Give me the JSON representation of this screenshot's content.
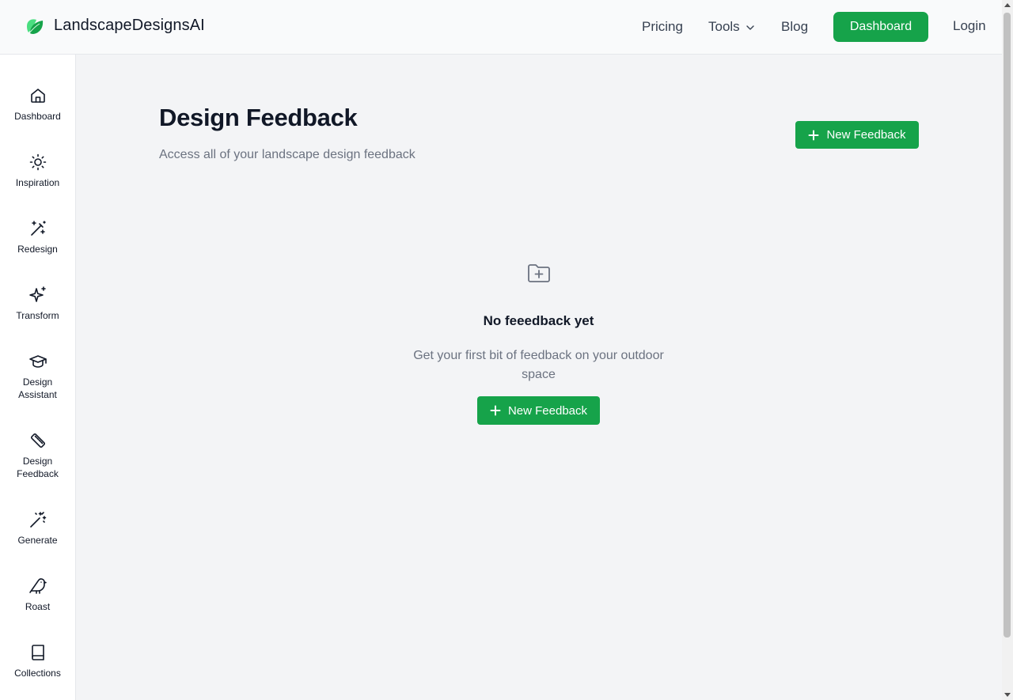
{
  "header": {
    "brand": "LandscapeDesignsAI",
    "nav": {
      "pricing": "Pricing",
      "tools": "Tools",
      "blog": "Blog",
      "dashboard": "Dashboard",
      "login": "Login"
    }
  },
  "sidebar": {
    "items": [
      {
        "label": "Dashboard",
        "icon": "home-icon"
      },
      {
        "label": "Inspiration",
        "icon": "sun-icon"
      },
      {
        "label": "Redesign",
        "icon": "magic-wand-icon"
      },
      {
        "label": "Transform",
        "icon": "sparkles-icon"
      },
      {
        "label": "Design Assistant",
        "icon": "graduation-cap-icon"
      },
      {
        "label": "Design Feedback",
        "icon": "ruler-icon"
      },
      {
        "label": "Generate",
        "icon": "wand-sparkles-icon"
      },
      {
        "label": "Roast",
        "icon": "bird-icon"
      },
      {
        "label": "Collections",
        "icon": "book-icon"
      }
    ]
  },
  "main": {
    "title": "Design Feedback",
    "subtitle": "Access all of your landscape design feedback",
    "new_button": "New Feedback",
    "empty": {
      "icon": "folder-plus-icon",
      "title": "No feeedback yet",
      "subtitle": "Get your first bit of feedback on your outdoor space",
      "button": "New Feedback"
    }
  },
  "colors": {
    "accent": "#16a34a",
    "background": "#f3f4f6",
    "text_muted": "#6b7280"
  }
}
